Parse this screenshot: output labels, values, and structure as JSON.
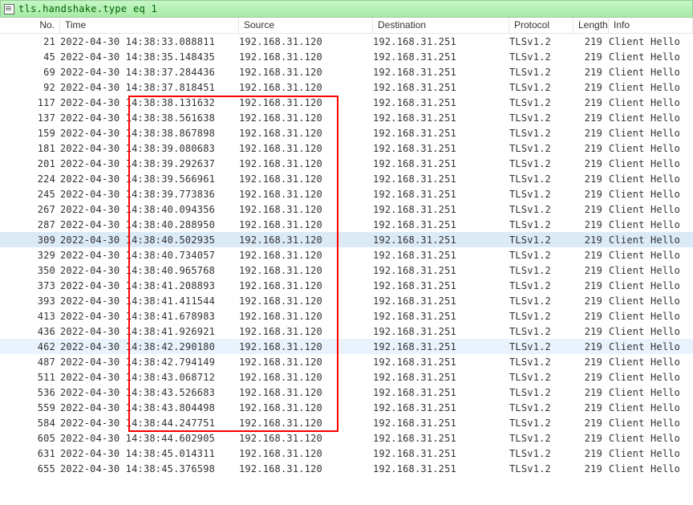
{
  "filter": {
    "text": "tls.handshake.type eq 1"
  },
  "columns": {
    "no": "No.",
    "time": "Time",
    "src": "Source",
    "dst": "Destination",
    "proto": "Protocol",
    "len": "Length",
    "info": "Info"
  },
  "rows": [
    {
      "no": 21,
      "date": "2022-04-30",
      "time": "14:38:33.088811",
      "src": "192.168.31.120",
      "dst": "192.168.31.251",
      "proto": "TLSv1.2",
      "len": 219,
      "info": "Client Hello"
    },
    {
      "no": 45,
      "date": "2022-04-30",
      "time": "14:38:35.148435",
      "src": "192.168.31.120",
      "dst": "192.168.31.251",
      "proto": "TLSv1.2",
      "len": 219,
      "info": "Client Hello"
    },
    {
      "no": 69,
      "date": "2022-04-30",
      "time": "14:38:37.284436",
      "src": "192.168.31.120",
      "dst": "192.168.31.251",
      "proto": "TLSv1.2",
      "len": 219,
      "info": "Client Hello"
    },
    {
      "no": 92,
      "date": "2022-04-30",
      "time": "14:38:37.818451",
      "src": "192.168.31.120",
      "dst": "192.168.31.251",
      "proto": "TLSv1.2",
      "len": 219,
      "info": "Client Hello"
    },
    {
      "no": 117,
      "date": "2022-04-30",
      "time": "14:38:38.131632",
      "src": "192.168.31.120",
      "dst": "192.168.31.251",
      "proto": "TLSv1.2",
      "len": 219,
      "info": "Client Hello"
    },
    {
      "no": 137,
      "date": "2022-04-30",
      "time": "14:38:38.561638",
      "src": "192.168.31.120",
      "dst": "192.168.31.251",
      "proto": "TLSv1.2",
      "len": 219,
      "info": "Client Hello"
    },
    {
      "no": 159,
      "date": "2022-04-30",
      "time": "14:38:38.867898",
      "src": "192.168.31.120",
      "dst": "192.168.31.251",
      "proto": "TLSv1.2",
      "len": 219,
      "info": "Client Hello"
    },
    {
      "no": 181,
      "date": "2022-04-30",
      "time": "14:38:39.080683",
      "src": "192.168.31.120",
      "dst": "192.168.31.251",
      "proto": "TLSv1.2",
      "len": 219,
      "info": "Client Hello"
    },
    {
      "no": 201,
      "date": "2022-04-30",
      "time": "14:38:39.292637",
      "src": "192.168.31.120",
      "dst": "192.168.31.251",
      "proto": "TLSv1.2",
      "len": 219,
      "info": "Client Hello"
    },
    {
      "no": 224,
      "date": "2022-04-30",
      "time": "14:38:39.566961",
      "src": "192.168.31.120",
      "dst": "192.168.31.251",
      "proto": "TLSv1.2",
      "len": 219,
      "info": "Client Hello"
    },
    {
      "no": 245,
      "date": "2022-04-30",
      "time": "14:38:39.773836",
      "src": "192.168.31.120",
      "dst": "192.168.31.251",
      "proto": "TLSv1.2",
      "len": 219,
      "info": "Client Hello"
    },
    {
      "no": 267,
      "date": "2022-04-30",
      "time": "14:38:40.094356",
      "src": "192.168.31.120",
      "dst": "192.168.31.251",
      "proto": "TLSv1.2",
      "len": 219,
      "info": "Client Hello"
    },
    {
      "no": 287,
      "date": "2022-04-30",
      "time": "14:38:40.288950",
      "src": "192.168.31.120",
      "dst": "192.168.31.251",
      "proto": "TLSv1.2",
      "len": 219,
      "info": "Client Hello"
    },
    {
      "no": 309,
      "date": "2022-04-30",
      "time": "14:38:40.502935",
      "src": "192.168.31.120",
      "dst": "192.168.31.251",
      "proto": "TLSv1.2",
      "len": 219,
      "info": "Client Hello",
      "sel": true
    },
    {
      "no": 329,
      "date": "2022-04-30",
      "time": "14:38:40.734057",
      "src": "192.168.31.120",
      "dst": "192.168.31.251",
      "proto": "TLSv1.2",
      "len": 219,
      "info": "Client Hello"
    },
    {
      "no": 350,
      "date": "2022-04-30",
      "time": "14:38:40.965768",
      "src": "192.168.31.120",
      "dst": "192.168.31.251",
      "proto": "TLSv1.2",
      "len": 219,
      "info": "Client Hello"
    },
    {
      "no": 373,
      "date": "2022-04-30",
      "time": "14:38:41.208893",
      "src": "192.168.31.120",
      "dst": "192.168.31.251",
      "proto": "TLSv1.2",
      "len": 219,
      "info": "Client Hello"
    },
    {
      "no": 393,
      "date": "2022-04-30",
      "time": "14:38:41.411544",
      "src": "192.168.31.120",
      "dst": "192.168.31.251",
      "proto": "TLSv1.2",
      "len": 219,
      "info": "Client Hello"
    },
    {
      "no": 413,
      "date": "2022-04-30",
      "time": "14:38:41.678983",
      "src": "192.168.31.120",
      "dst": "192.168.31.251",
      "proto": "TLSv1.2",
      "len": 219,
      "info": "Client Hello"
    },
    {
      "no": 436,
      "date": "2022-04-30",
      "time": "14:38:41.926921",
      "src": "192.168.31.120",
      "dst": "192.168.31.251",
      "proto": "TLSv1.2",
      "len": 219,
      "info": "Client Hello"
    },
    {
      "no": 462,
      "date": "2022-04-30",
      "time": "14:38:42.290180",
      "src": "192.168.31.120",
      "dst": "192.168.31.251",
      "proto": "TLSv1.2",
      "len": 219,
      "info": "Client Hello",
      "hl": true
    },
    {
      "no": 487,
      "date": "2022-04-30",
      "time": "14:38:42.794149",
      "src": "192.168.31.120",
      "dst": "192.168.31.251",
      "proto": "TLSv1.2",
      "len": 219,
      "info": "Client Hello"
    },
    {
      "no": 511,
      "date": "2022-04-30",
      "time": "14:38:43.068712",
      "src": "192.168.31.120",
      "dst": "192.168.31.251",
      "proto": "TLSv1.2",
      "len": 219,
      "info": "Client Hello"
    },
    {
      "no": 536,
      "date": "2022-04-30",
      "time": "14:38:43.526683",
      "src": "192.168.31.120",
      "dst": "192.168.31.251",
      "proto": "TLSv1.2",
      "len": 219,
      "info": "Client Hello"
    },
    {
      "no": 559,
      "date": "2022-04-30",
      "time": "14:38:43.804498",
      "src": "192.168.31.120",
      "dst": "192.168.31.251",
      "proto": "TLSv1.2",
      "len": 219,
      "info": "Client Hello"
    },
    {
      "no": 584,
      "date": "2022-04-30",
      "time": "14:38:44.247751",
      "src": "192.168.31.120",
      "dst": "192.168.31.251",
      "proto": "TLSv1.2",
      "len": 219,
      "info": "Client Hello"
    },
    {
      "no": 605,
      "date": "2022-04-30",
      "time": "14:38:44.602905",
      "src": "192.168.31.120",
      "dst": "192.168.31.251",
      "proto": "TLSv1.2",
      "len": 219,
      "info": "Client Hello"
    },
    {
      "no": 631,
      "date": "2022-04-30",
      "time": "14:38:45.014311",
      "src": "192.168.31.120",
      "dst": "192.168.31.251",
      "proto": "TLSv1.2",
      "len": 219,
      "info": "Client Hello"
    },
    {
      "no": 655,
      "date": "2022-04-30",
      "time": "14:38:45.376598",
      "src": "192.168.31.120",
      "dst": "192.168.31.251",
      "proto": "TLSv1.2",
      "len": 219,
      "info": "Client Hello"
    }
  ]
}
